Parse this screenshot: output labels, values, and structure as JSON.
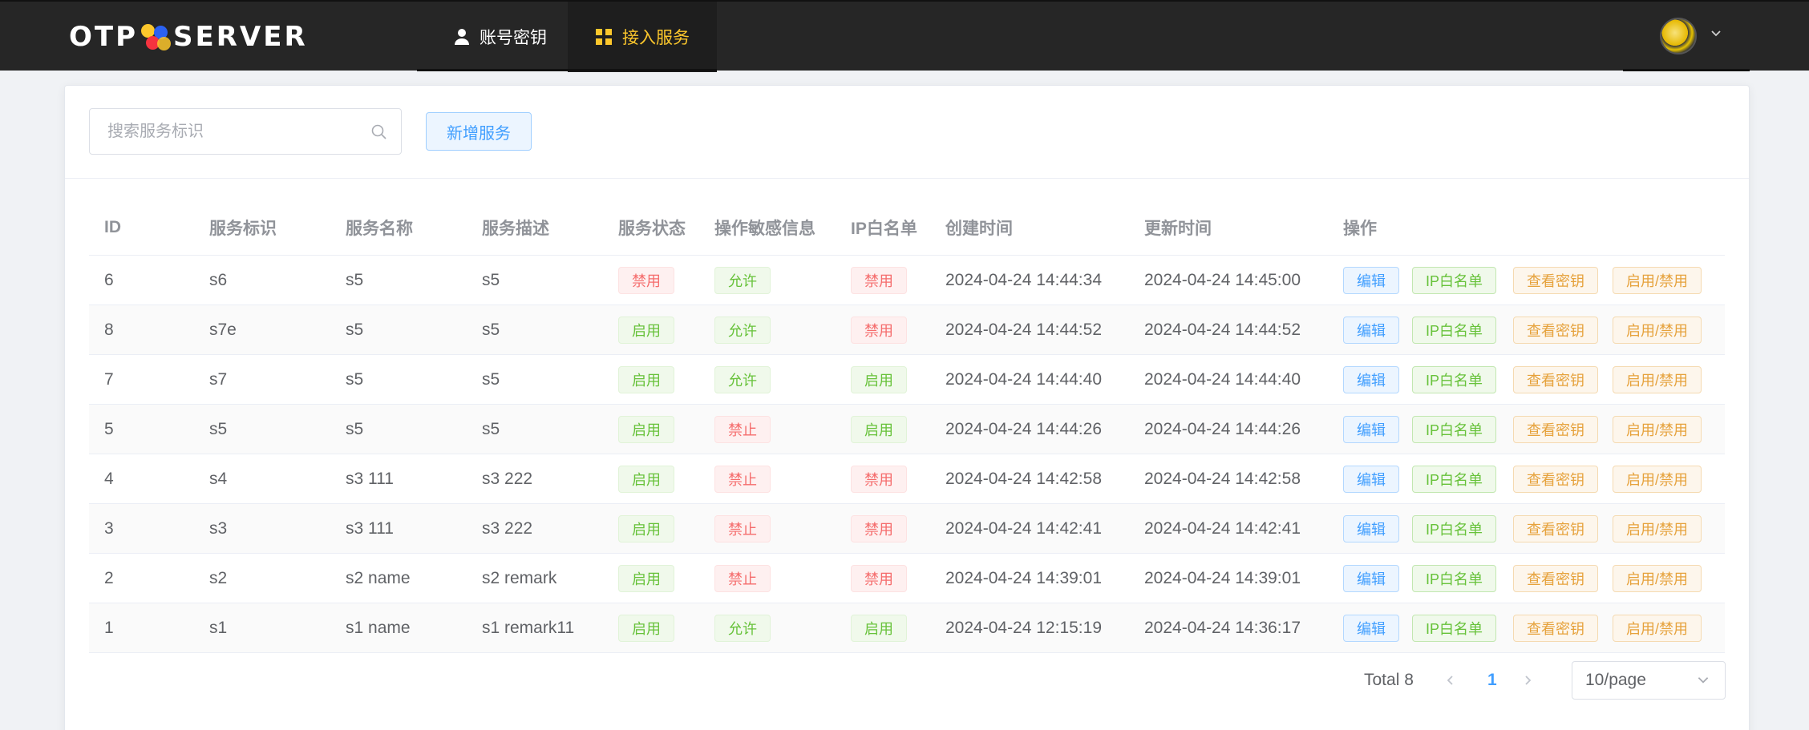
{
  "header": {
    "logo_left": "OTP",
    "logo_right": "SERVER",
    "nav": [
      {
        "label": "账号密钥",
        "icon": "user-icon",
        "active": false
      },
      {
        "label": "接入服务",
        "icon": "grid-icon",
        "active": true
      }
    ],
    "avatar_icon": "avatar-icon",
    "colors": {
      "bg": "#262626",
      "active": "#fcc72c",
      "logo_dot_red": "#f5333f",
      "logo_dot_yellow": "#fcc72c",
      "logo_dot_blue": "#2b62f2"
    }
  },
  "toolbar": {
    "search_placeholder": "搜索服务标识",
    "search_value": "",
    "add_label": "新增服务"
  },
  "table": {
    "columns": [
      "ID",
      "服务标识",
      "服务名称",
      "服务描述",
      "服务状态",
      "操作敏感信息",
      "IP白名单",
      "创建时间",
      "更新时间",
      "操作"
    ],
    "actions": [
      "编辑",
      "IP白名单",
      "查看密钥",
      "启用/禁用"
    ],
    "rows": [
      {
        "id": "6",
        "key": "s6",
        "name": "s5",
        "desc": "s5",
        "status": "禁用",
        "sensitive": "允许",
        "ip": "禁用",
        "created": "2024-04-24 14:44:34",
        "updated": "2024-04-24 14:45:00"
      },
      {
        "id": "8",
        "key": "s7e",
        "name": "s5",
        "desc": "s5",
        "status": "启用",
        "sensitive": "允许",
        "ip": "禁用",
        "created": "2024-04-24 14:44:52",
        "updated": "2024-04-24 14:44:52"
      },
      {
        "id": "7",
        "key": "s7",
        "name": "s5",
        "desc": "s5",
        "status": "启用",
        "sensitive": "允许",
        "ip": "启用",
        "created": "2024-04-24 14:44:40",
        "updated": "2024-04-24 14:44:40"
      },
      {
        "id": "5",
        "key": "s5",
        "name": "s5",
        "desc": "s5",
        "status": "启用",
        "sensitive": "禁止",
        "ip": "启用",
        "created": "2024-04-24 14:44:26",
        "updated": "2024-04-24 14:44:26"
      },
      {
        "id": "4",
        "key": "s4",
        "name": "s3 111",
        "desc": "s3 222",
        "status": "启用",
        "sensitive": "禁止",
        "ip": "禁用",
        "created": "2024-04-24 14:42:58",
        "updated": "2024-04-24 14:42:58"
      },
      {
        "id": "3",
        "key": "s3",
        "name": "s3 111",
        "desc": "s3 222",
        "status": "启用",
        "sensitive": "禁止",
        "ip": "禁用",
        "created": "2024-04-24 14:42:41",
        "updated": "2024-04-24 14:42:41"
      },
      {
        "id": "2",
        "key": "s2",
        "name": "s2 name",
        "desc": "s2 remark",
        "status": "启用",
        "sensitive": "禁止",
        "ip": "禁用",
        "created": "2024-04-24 14:39:01",
        "updated": "2024-04-24 14:39:01"
      },
      {
        "id": "1",
        "key": "s1",
        "name": "s1 name",
        "desc": "s1 remark11",
        "status": "启用",
        "sensitive": "允许",
        "ip": "启用",
        "created": "2024-04-24 12:15:19",
        "updated": "2024-04-24 14:36:17"
      }
    ],
    "positive_values": [
      "启用",
      "允许"
    ]
  },
  "pagination": {
    "total_label": "Total 8",
    "current_page": "1",
    "page_size": "10/page"
  }
}
